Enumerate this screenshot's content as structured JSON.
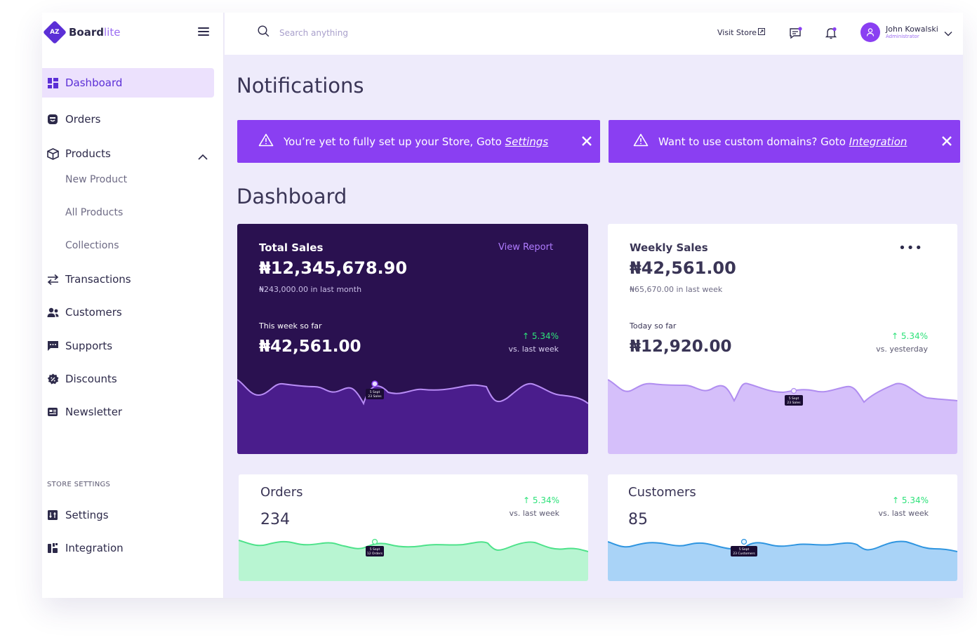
{
  "app": {
    "logo_badge": "AZ",
    "name_bold": "Board",
    "name_light": "lite"
  },
  "sidebar": {
    "items": [
      {
        "label": "Dashboard",
        "icon": "dashboard-icon"
      },
      {
        "label": "Orders",
        "icon": "orders-icon"
      },
      {
        "label": "Products",
        "icon": "products-icon",
        "expanded": true
      },
      {
        "label": "Transactions",
        "icon": "transactions-icon"
      },
      {
        "label": "Customers",
        "icon": "customers-icon"
      },
      {
        "label": "Supports",
        "icon": "supports-icon"
      },
      {
        "label": "Discounts",
        "icon": "discounts-icon"
      },
      {
        "label": "Newsletter",
        "icon": "newsletter-icon"
      }
    ],
    "product_subitems": [
      "New Product",
      "All Products",
      "Collections"
    ],
    "store_settings_label": "STORE SETTINGS",
    "settings_items": [
      {
        "label": "Settings",
        "icon": "settings-icon"
      },
      {
        "label": "Integration",
        "icon": "integration-icon"
      }
    ]
  },
  "header": {
    "search_placeholder": "Search anything",
    "visit_store": "Visit Store",
    "user_name": "John Kowalski",
    "user_role": "Administrator"
  },
  "notifications": {
    "title": "Notifications",
    "alerts": [
      {
        "text": "You’re yet to fully set up your Store, Goto ",
        "link": "Settings"
      },
      {
        "text": "Want to use custom domains? Goto ",
        "link": "Integration"
      }
    ]
  },
  "dashboard": {
    "title": "Dashboard",
    "total_sales": {
      "title": "Total Sales",
      "view_report": "View Report",
      "value": "₦12,345,678.90",
      "sub": "₦243,000.00 in last month",
      "week_label": "This week so far",
      "week_value": "₦42,561.00",
      "change": "5.34%",
      "vs": "vs. last week",
      "tooltip_date": "5 Sept",
      "tooltip_value": "23 Sales"
    },
    "weekly_sales": {
      "title": "Weekly Sales",
      "value": "₦42,561.00",
      "sub": "₦65,670.00 in last week",
      "week_label": "Today so far",
      "week_value": "₦12,920.00",
      "change": "5.34%",
      "vs": "vs. yesterday",
      "tooltip_date": "5 Sept",
      "tooltip_value": "23 Sales"
    },
    "orders": {
      "title": "Orders",
      "value": "234",
      "change": "5.34%",
      "vs": "vs. last week",
      "tooltip_date": "5 Sept",
      "tooltip_value": "12 Orders"
    },
    "customers": {
      "title": "Customers",
      "value": "85",
      "change": "5.34%",
      "vs": "vs. last week",
      "tooltip_date": "5 Sept",
      "tooltip_value": "23 Customers"
    }
  },
  "colors": {
    "accent": "#8a3ff2",
    "dark_card": "#2a1150",
    "dark_fill": "#4a1d8c",
    "positive": "#2ee27a",
    "weekly_fill": "#d5bffa",
    "orders_fill": "#b8f5d2",
    "customers_fill": "#a9d3f7"
  }
}
